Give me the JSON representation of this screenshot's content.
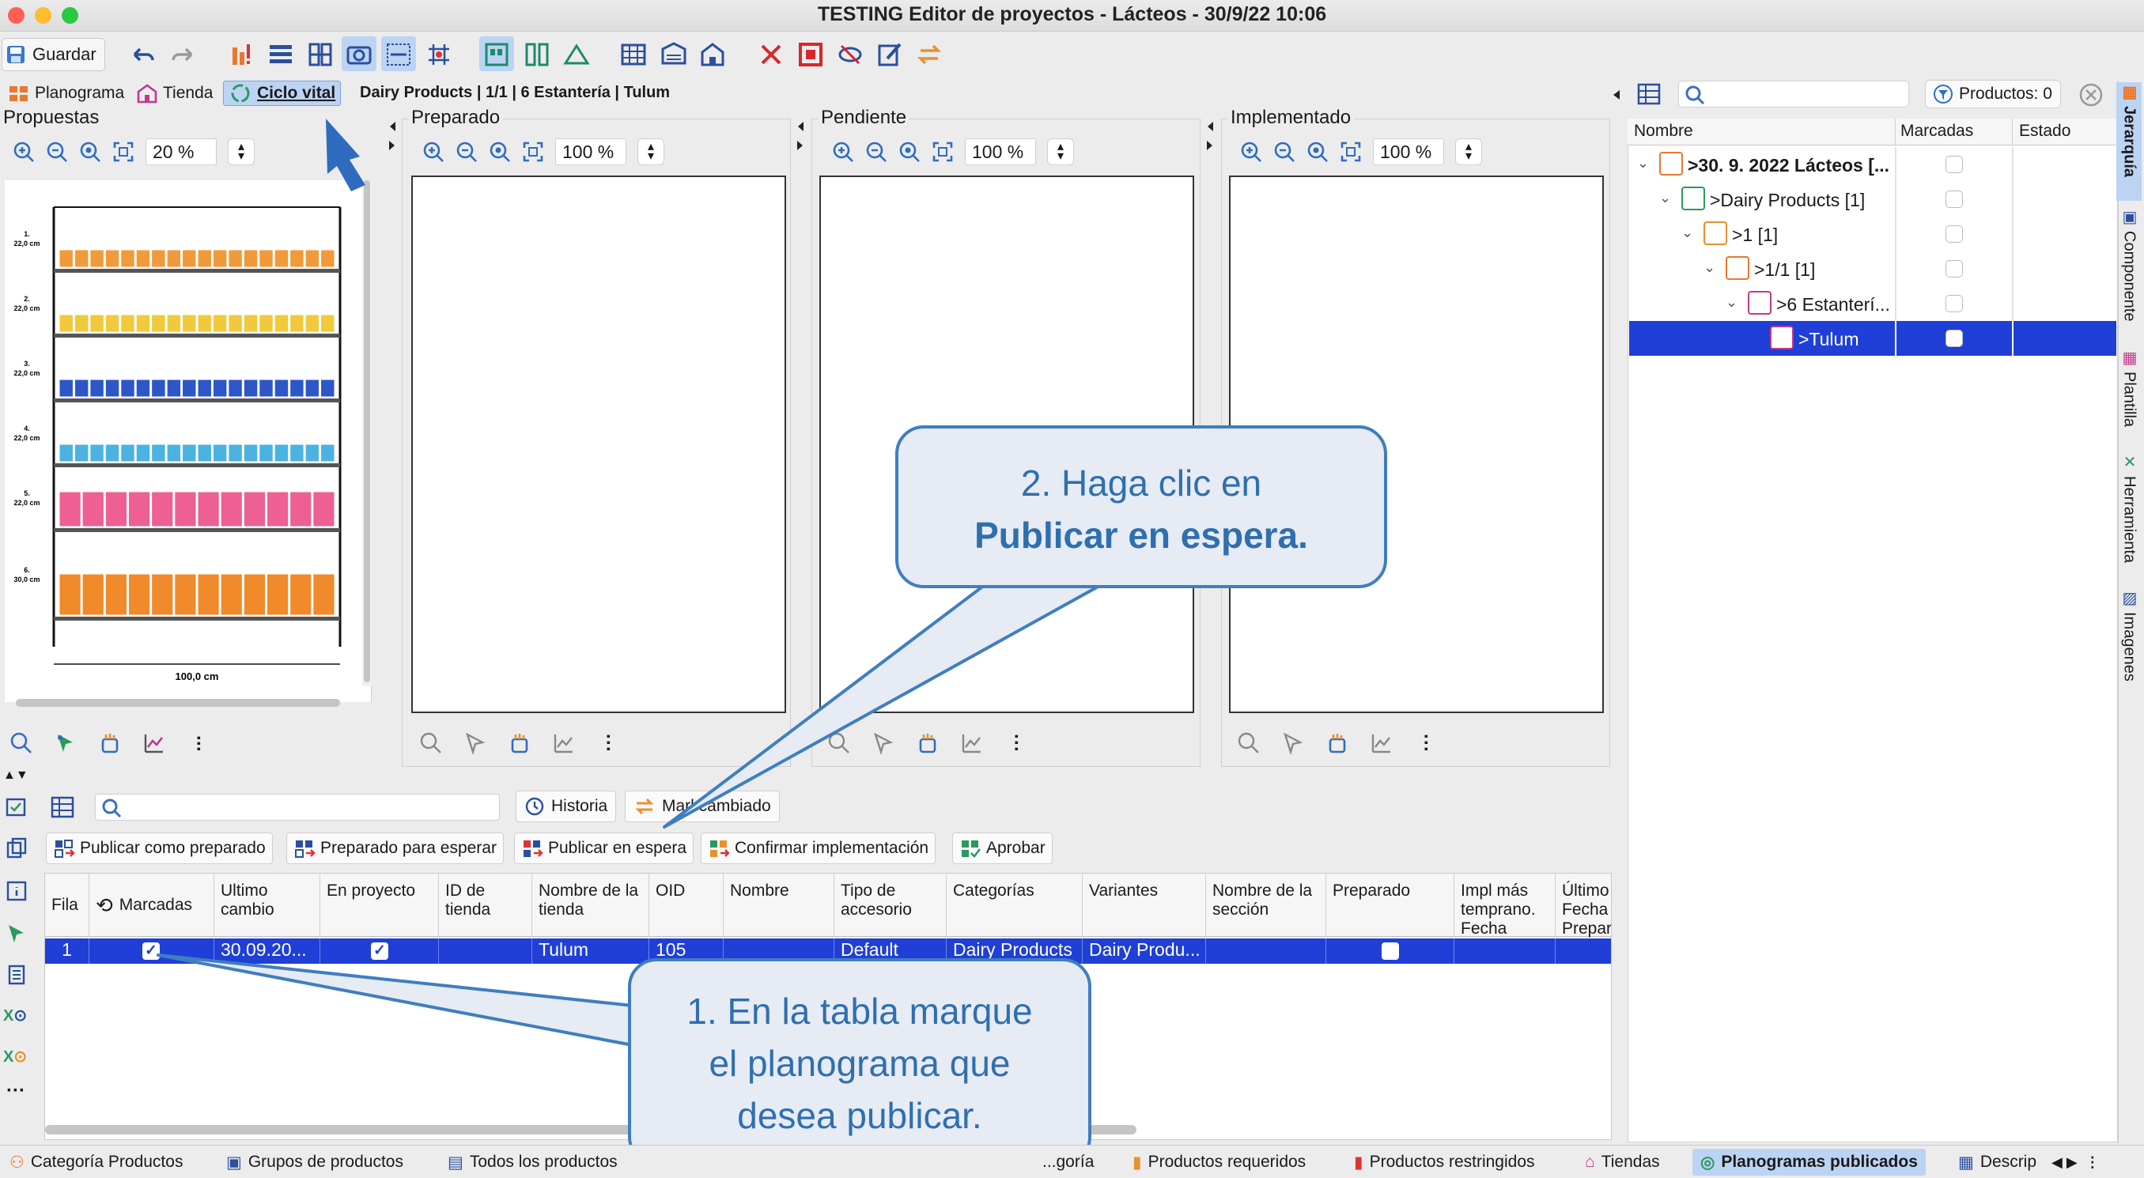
{
  "window": {
    "title": "TESTING Editor de proyectos - Lácteos - 30/9/22 10:06"
  },
  "toolbar": {
    "save_label": "Guardar"
  },
  "view_tabs": [
    {
      "label": "Planograma"
    },
    {
      "label": "Tienda"
    },
    {
      "label": "Ciclo vital"
    }
  ],
  "breadcrumb": "Dairy Products | 1/1 | 6 Estantería | Tulum",
  "panels": [
    {
      "title": "Propuestas",
      "zoom": "20 %"
    },
    {
      "title": "Preparado",
      "zoom": "100 %"
    },
    {
      "title": "Pendiente",
      "zoom": "100 %"
    },
    {
      "title": "Implementado",
      "zoom": "100 %"
    }
  ],
  "planogram": {
    "shelves": [
      {
        "label": "1.",
        "height": "22,0 cm",
        "color": "#f29a3a"
      },
      {
        "label": "2.",
        "height": "22,0 cm",
        "color": "#f2c93a"
      },
      {
        "label": "3.",
        "height": "22,0 cm",
        "color": "#2d56c8"
      },
      {
        "label": "4.",
        "height": "22,0 cm",
        "color": "#4ab3e2"
      },
      {
        "label": "5.",
        "height": "22,0 cm",
        "color": "#ee5f93"
      },
      {
        "label": "6.",
        "height": "30,0 cm",
        "color": "#f08a2a"
      }
    ],
    "width_label": "100,0 cm"
  },
  "right_panel": {
    "search_placeholder": "",
    "products_filter": "Productos: 0",
    "columns": [
      "Nombre",
      "Marcadas",
      "Estado"
    ],
    "tree": [
      {
        "label": ">30. 9. 2022 Lácteos [...",
        "indent": 0,
        "bold": true,
        "icon": "hierarchy-icon"
      },
      {
        "label": ">Dairy Products [1]",
        "indent": 1,
        "bold": false,
        "icon": "category-icon"
      },
      {
        "label": ">1 [1]",
        "indent": 2,
        "bold": false,
        "icon": "cluster-icon"
      },
      {
        "label": ">1/1 [1]",
        "indent": 3,
        "bold": false,
        "icon": "group-icon"
      },
      {
        "label": ">6 Estanterí...",
        "indent": 4,
        "bold": false,
        "icon": "store-icon"
      },
      {
        "label": ">Tulum",
        "indent": 5,
        "bold": false,
        "icon": "store-icon",
        "selected": true
      }
    ]
  },
  "right_tabs": [
    "Jerarquía",
    "Componente",
    "Plantilla",
    "Herramienta",
    "Imagenes"
  ],
  "bottom": {
    "search_placeholder": "",
    "history_label": "Historia",
    "mark_changed_label": "Marl cambiado",
    "actions": [
      "Publicar como preparado",
      "Preparado para esperar",
      "Publicar en espera",
      "Confirmar implementación",
      "Aprobar"
    ],
    "table": {
      "columns": [
        "Fila",
        "Marcadas",
        "Ultimo cambio",
        "En proyecto",
        "ID de tienda",
        "Nombre de la tienda",
        "OID",
        "Nombre",
        "Tipo de accesorio",
        "Categorías",
        "Variantes",
        "Nombre de la sección",
        "Preparado",
        "Impl más temprano. Fecha",
        "Último Fecha Prepar"
      ],
      "row": {
        "fila": "1",
        "marcadas": true,
        "ultimo_cambio": "30.09.20...",
        "en_proyecto": true,
        "id_tienda": "",
        "nombre_tienda": "Tulum",
        "oid": "105",
        "nombre": "",
        "tipo": "Default",
        "categorias": "Dairy Products",
        "variantes": "Dairy Produ...",
        "seccion": "",
        "preparado": false
      }
    }
  },
  "bottom_tabs": [
    "Categoría Productos",
    "Grupos de productos",
    "Todos los productos",
    "...goría",
    "Productos requeridos",
    "Productos restringidos",
    "Tiendas",
    "Planogramas publicados",
    "Descrip"
  ],
  "callouts": {
    "step1": "1. En la tabla marque el planograma que desea publicar.",
    "step2_line1": "2. Haga clic en",
    "step2_line2": "Publicar en espera."
  },
  "colors": {
    "accent": "#1f3fd6",
    "callout_border": "#3f7ec0",
    "callout_fill": "#e6ebf4"
  }
}
